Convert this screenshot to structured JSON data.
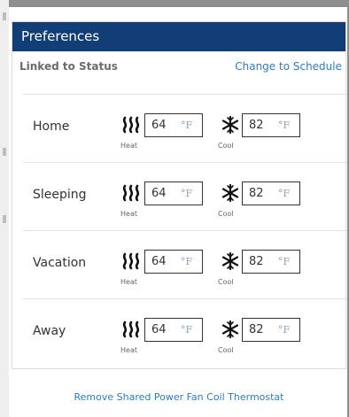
{
  "header": {
    "title": "Preferences"
  },
  "status": {
    "linked": "Linked to Status",
    "change": "Change to Schedule"
  },
  "labels": {
    "heat": "Heat",
    "cool": "Cool",
    "unit": "°F"
  },
  "rows": [
    {
      "name": "Home",
      "heat": "64",
      "cool": "82"
    },
    {
      "name": "Sleeping",
      "heat": "64",
      "cool": "82"
    },
    {
      "name": "Vacation",
      "heat": "64",
      "cool": "82"
    },
    {
      "name": "Away",
      "heat": "64",
      "cool": "82"
    }
  ],
  "footer": {
    "remove": "Remove Shared Power Fan Coil Thermostat"
  },
  "colors": {
    "header_bg": "#123e78",
    "link": "#2b7cc4",
    "unit": "#8aa3bf"
  },
  "icons": {
    "heat": "heat-waves-icon",
    "cool": "snowflake-icon"
  }
}
